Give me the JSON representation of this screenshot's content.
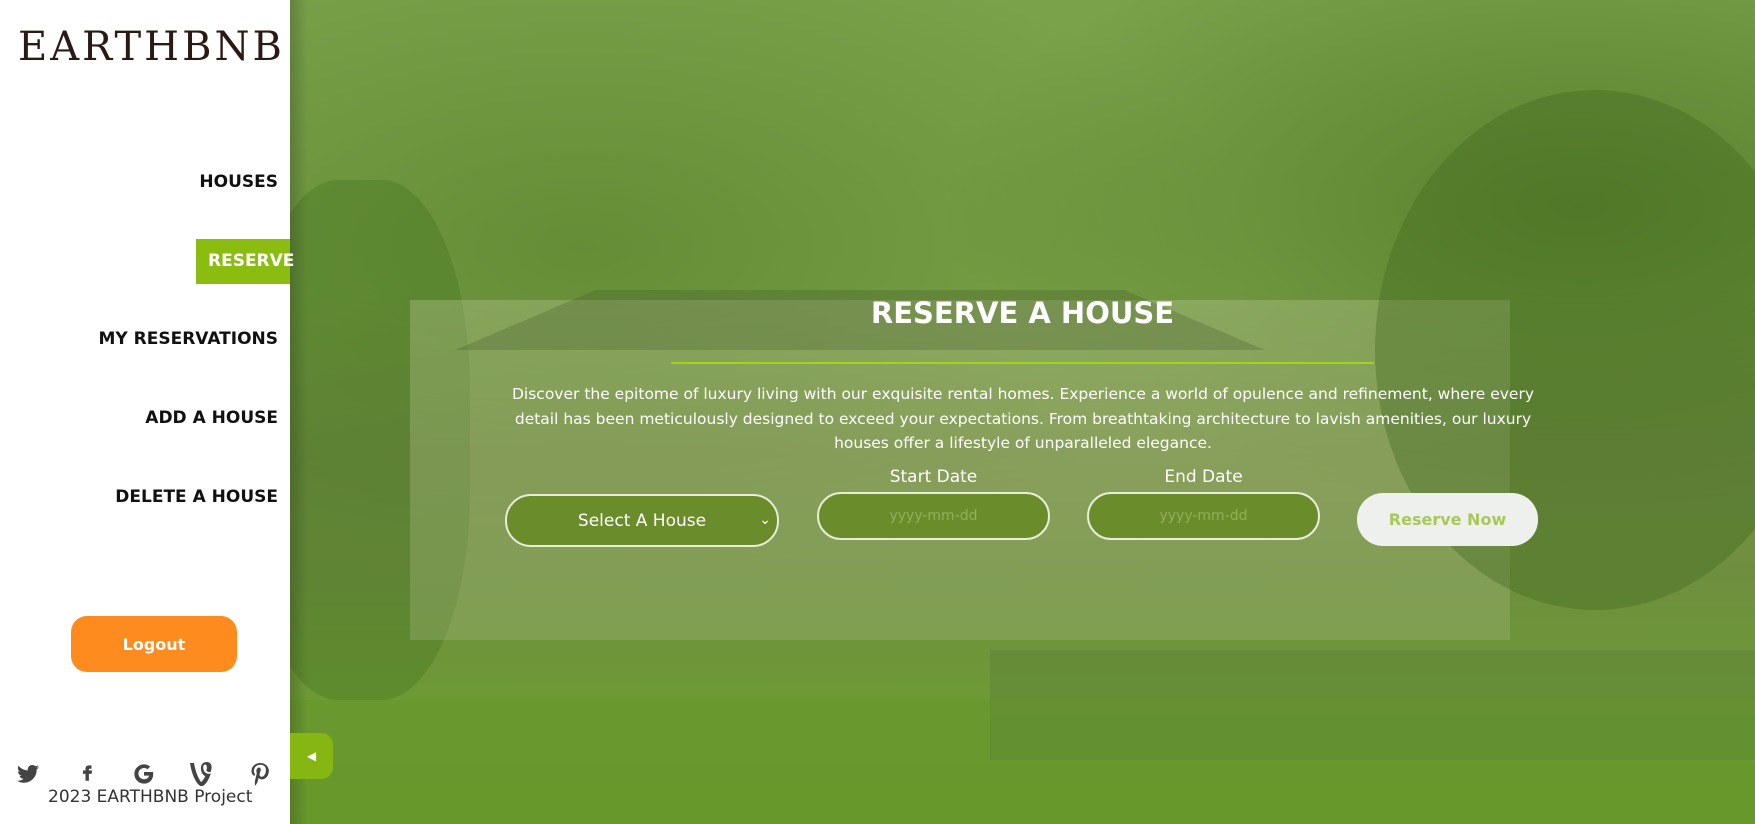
{
  "brand": {
    "logo_text": "EARTHBNB"
  },
  "nav": {
    "items": [
      {
        "label": "HOUSES",
        "active": false
      },
      {
        "label": "RESERVE",
        "active": true
      },
      {
        "label": "MY RESERVATIONS",
        "active": false
      },
      {
        "label": "ADD A HOUSE",
        "active": false
      },
      {
        "label": "DELETE A HOUSE",
        "active": false
      }
    ]
  },
  "sidebar": {
    "logout_label": "Logout",
    "socials": [
      "twitter-icon",
      "facebook-icon",
      "google-icon",
      "vine-icon",
      "pinterest-icon"
    ],
    "copyright": "2023 EARTHBNB Project"
  },
  "main": {
    "title": "RESERVE A HOUSE",
    "description": "Discover the epitome of luxury living with our exquisite rental homes. Experience a world of opulence and refinement, where every detail has been meticulously designed to exceed your expectations. From breathtaking architecture to lavish amenities, our luxury houses offer a lifestyle of unparalleled elegance.",
    "form": {
      "house_select": "Select A House",
      "start_date_label": "Start Date",
      "end_date_label": "End Date",
      "start_date_placeholder": "yyyy-mm-dd",
      "end_date_placeholder": "yyyy-mm-dd",
      "submit_label": "Reserve Now"
    }
  },
  "colors": {
    "accent": "#8bbd10",
    "logout": "#fd8b1d",
    "overlay": "#7aa24b"
  }
}
